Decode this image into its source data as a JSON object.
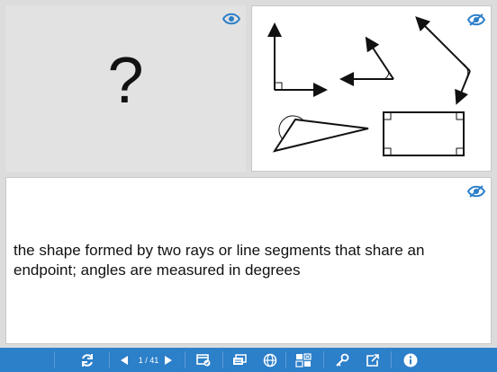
{
  "card": {
    "term": "?",
    "definition": "the shape formed by two rays or line segments that share an endpoint; angles are measured in degrees"
  },
  "icons": {
    "term_visibility": "eye-icon",
    "image_visibility": "eye-off-icon",
    "definition_visibility": "eye-off-icon"
  },
  "toolbar": {
    "page_indicator": "1 / 41",
    "buttons": [
      "refresh-icon",
      "prev-icon",
      "next-icon",
      "card-check-icon",
      "cards-icon",
      "globe-icon",
      "grid-shuffle-icon",
      "key-icon",
      "share-icon",
      "info-icon"
    ]
  },
  "colors": {
    "accent": "#2c7fc9",
    "toolbar_bg": "#2c7fc9"
  }
}
